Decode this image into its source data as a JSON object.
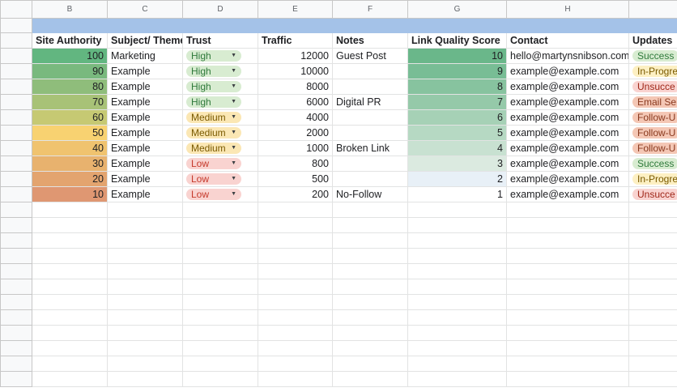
{
  "columns": [
    "",
    "B",
    "C",
    "D",
    "E",
    "F",
    "G",
    "H",
    ""
  ],
  "headers": {
    "site_authority": "Site Authority",
    "subject": "Subject/ Theme",
    "trust": "Trust",
    "traffic": "Traffic",
    "notes": "Notes",
    "link_quality": "Link Quality Score",
    "contact": "Contact",
    "updates": "Updates"
  },
  "rows": [
    {
      "site_authority": "100",
      "subject": "Marketing",
      "trust": "High",
      "traffic": "12000",
      "notes": "Guest Post",
      "link_quality": "10",
      "contact": "hello@martynsnibson.com",
      "update": "Success"
    },
    {
      "site_authority": "90",
      "subject": "Example",
      "trust": "High",
      "traffic": "10000",
      "notes": "",
      "link_quality": "9",
      "contact": "example@example.com",
      "update": "In-Progre"
    },
    {
      "site_authority": "80",
      "subject": "Example",
      "trust": "High",
      "traffic": "8000",
      "notes": "",
      "link_quality": "8",
      "contact": "example@example.com",
      "update": "Unsucce"
    },
    {
      "site_authority": "70",
      "subject": "Example",
      "trust": "High",
      "traffic": "6000",
      "notes": "Digital PR",
      "link_quality": "7",
      "contact": "example@example.com",
      "update": "Email Se"
    },
    {
      "site_authority": "60",
      "subject": "Example",
      "trust": "Medium",
      "traffic": "4000",
      "notes": "",
      "link_quality": "6",
      "contact": "example@example.com",
      "update": "Follow-U"
    },
    {
      "site_authority": "50",
      "subject": "Example",
      "trust": "Medium",
      "traffic": "2000",
      "notes": "",
      "link_quality": "5",
      "contact": "example@example.com",
      "update": "Follow-U"
    },
    {
      "site_authority": "40",
      "subject": "Example",
      "trust": "Medium",
      "traffic": "1000",
      "notes": "Broken Link",
      "link_quality": "4",
      "contact": "example@example.com",
      "update": "Follow-U"
    },
    {
      "site_authority": "30",
      "subject": "Example",
      "trust": "Low",
      "traffic": "800",
      "notes": "",
      "link_quality": "3",
      "contact": "example@example.com",
      "update": "Success"
    },
    {
      "site_authority": "20",
      "subject": "Example",
      "trust": "Low",
      "traffic": "500",
      "notes": "",
      "link_quality": "2",
      "contact": "example@example.com",
      "update": "In-Progre"
    },
    {
      "site_authority": "10",
      "subject": "Example",
      "trust": "Low",
      "traffic": "200",
      "notes": "No-Follow",
      "link_quality": "1",
      "contact": "example@example.com",
      "update": "Unsucce"
    }
  ],
  "colors": {
    "authority": [
      "#62b680",
      "#79b97e",
      "#8fbd7b",
      "#a8c277",
      "#c6c973",
      "#f8d271",
      "#f0c36f",
      "#e8b26e",
      "#e3a46f",
      "#df9772"
    ],
    "quality": [
      "#6ab78a",
      "#78bd95",
      "#87c39f",
      "#95c9a9",
      "#a6d1b6",
      "#b6d9c3",
      "#c8e1d1",
      "#dbeae0",
      "#e8f0f7",
      "#ffffff"
    ],
    "trust": {
      "High": {
        "bg": "#d8ecd1",
        "fg": "#2f7a3b"
      },
      "Medium": {
        "bg": "#fbe7b4",
        "fg": "#7a5a00"
      },
      "Low": {
        "bg": "#f9d3d0",
        "fg": "#c5392b"
      }
    },
    "update": {
      "Success": {
        "bg": "#d8ecd1",
        "fg": "#2f7a3b"
      },
      "In-Progre": {
        "bg": "#fdf0c3",
        "fg": "#7a5a00"
      },
      "Unsucce": {
        "bg": "#f9d3d0",
        "fg": "#a0281a"
      },
      "Email Se": {
        "bg": "#f4c7b5",
        "fg": "#8a3a1f"
      },
      "Follow-U": {
        "bg": "#f4c7b5",
        "fg": "#8a3a1f"
      }
    },
    "band": "#a4c2e8"
  },
  "dropdown_icon": "triangle-down-icon",
  "empty_rows": 12
}
